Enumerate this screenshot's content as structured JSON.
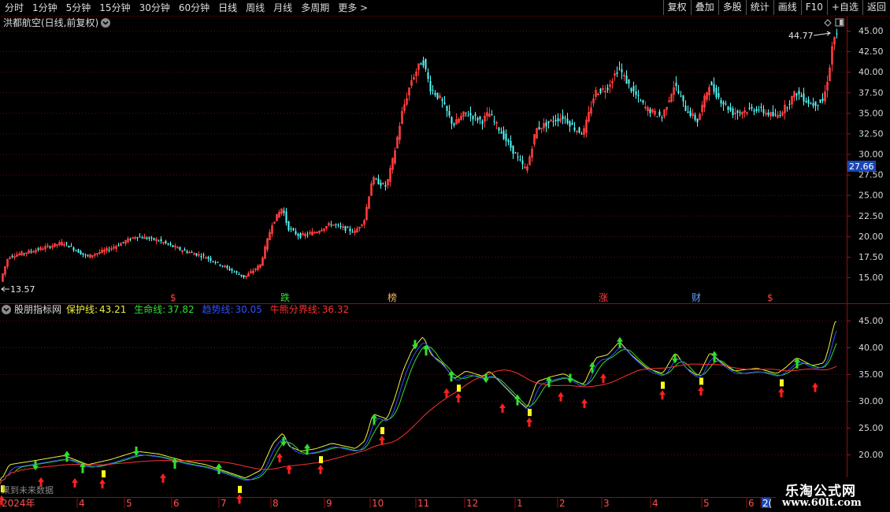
{
  "toolbar": {
    "periods": [
      "分时",
      "1分钟",
      "5分钟",
      "15分钟",
      "30分钟",
      "60分钟",
      "日线",
      "周线",
      "月线",
      "多周期",
      "更多 >"
    ],
    "active_period": "日线",
    "buttons": [
      "复权",
      "叠加",
      "多股",
      "统计",
      "画线",
      "F10",
      "+自选",
      "返回"
    ]
  },
  "main": {
    "stock_title": "洪都航空(日线,前复权)",
    "y_ticks": [
      "45.00",
      "42.50",
      "40.00",
      "37.50",
      "35.00",
      "32.50",
      "30.00",
      "27.50",
      "25.00",
      "22.50",
      "20.00",
      "17.50",
      "15.00"
    ],
    "current_price_tag": "27.66",
    "high_label": "44.77",
    "low_label": "13.57",
    "event_markers": [
      {
        "text": "$",
        "color": "#ff4040"
      },
      {
        "text": "跌",
        "color": "#30e030"
      },
      {
        "text": "榜",
        "color": "#ffb060"
      },
      {
        "text": "涨",
        "color": "#ff4040"
      },
      {
        "text": "财",
        "color": "#60a0ff"
      },
      {
        "text": "$",
        "color": "#ff4040"
      }
    ]
  },
  "indicator": {
    "name": "股朋指标网",
    "lines": [
      {
        "label": "保护线:",
        "value": "43.21",
        "color": "#f0f040"
      },
      {
        "label": "生命线:",
        "value": "37.82",
        "color": "#30e030"
      },
      {
        "label": "趋势线:",
        "value": "30.05",
        "color": "#3050ff"
      },
      {
        "label": "牛熊分界线:",
        "value": "36.32",
        "color": "#ff3030"
      }
    ],
    "y_ticks": [
      "45.00",
      "40.00",
      "35.00",
      "30.00",
      "25.00",
      "20.00"
    ]
  },
  "xaxis": {
    "labels": [
      "2024年",
      "4",
      "5",
      "6",
      "7",
      "8",
      "9",
      "10",
      "11",
      "12",
      "1",
      "2",
      "3",
      "4",
      "5",
      "6",
      "2("
    ]
  },
  "footer_note": "果到未来数据",
  "watermark": {
    "title": "乐淘公式网",
    "url": "www.60lt.com"
  },
  "chart_data": [
    {
      "type": "candlestick",
      "title": "洪都航空(日线,前复权)",
      "ylim": [
        13,
        46
      ],
      "key_points": {
        "min_price": 13.57,
        "max_price": 44.77,
        "last_tag": 27.66
      },
      "close_series_by_month": [
        {
          "month": "2024-03",
          "close": 17.5
        },
        {
          "month": "2024-04",
          "close": 18.5
        },
        {
          "month": "2024-05",
          "close": 19.5
        },
        {
          "month": "2024-06",
          "close": 18.5
        },
        {
          "month": "2024-07",
          "close": 15.5
        },
        {
          "month": "2024-08",
          "close": 20.5
        },
        {
          "month": "2024-09",
          "close": 21.0
        },
        {
          "month": "2024-10",
          "close": 27.0
        },
        {
          "month": "2024-11",
          "close": 37.0
        },
        {
          "month": "2024-12",
          "close": 33.5
        },
        {
          "month": "2025-01",
          "close": 30.5
        },
        {
          "month": "2025-02",
          "close": 34.0
        },
        {
          "month": "2025-03",
          "close": 38.0
        },
        {
          "month": "2025-04",
          "close": 35.5
        },
        {
          "month": "2025-05",
          "close": 35.0
        },
        {
          "month": "2025-06",
          "close": 40.5
        }
      ]
    },
    {
      "type": "line",
      "title": "股朋指标网",
      "ylim": [
        17,
        47
      ],
      "series": [
        {
          "name": "保护线",
          "last": 43.21
        },
        {
          "name": "生命线",
          "last": 37.82
        },
        {
          "name": "趋势线",
          "last": 30.05
        },
        {
          "name": "牛熊分界线",
          "last": 36.32
        }
      ]
    }
  ]
}
